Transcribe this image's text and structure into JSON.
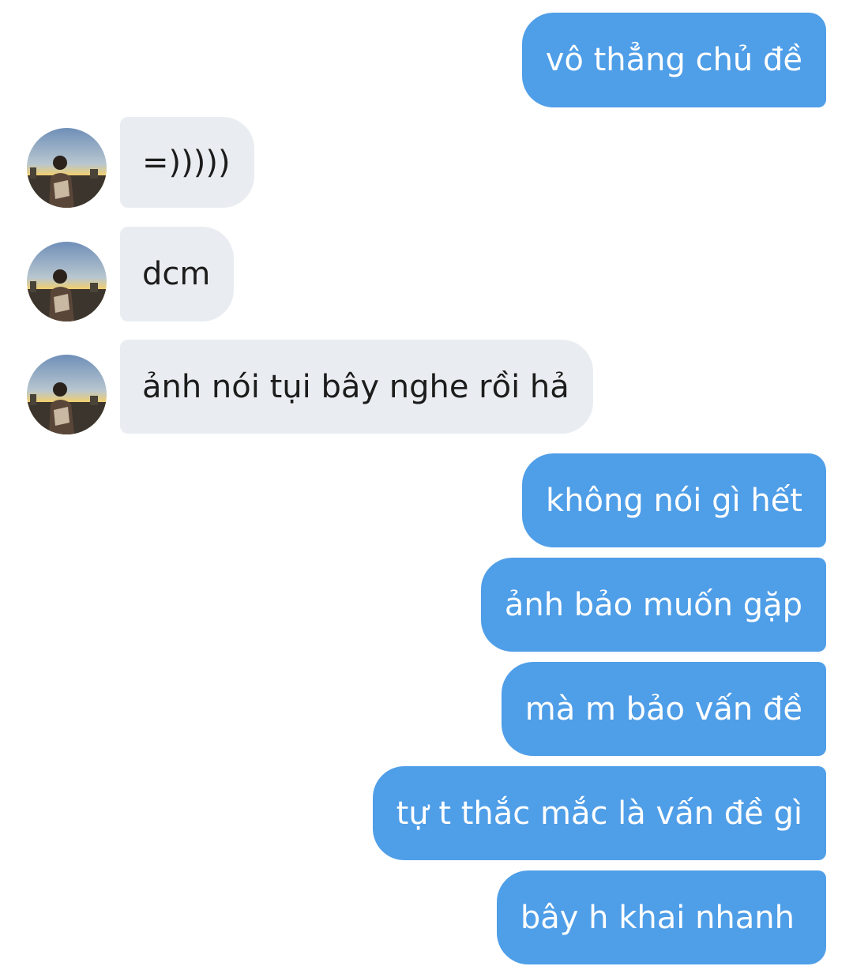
{
  "messages": [
    {
      "id": "m1",
      "direction": "outgoing",
      "text": "vô thẳng chủ đề"
    },
    {
      "id": "m2",
      "direction": "incoming",
      "text": "=)))))"
    },
    {
      "id": "m3",
      "direction": "incoming",
      "text": "dcm"
    },
    {
      "id": "m4",
      "direction": "incoming",
      "text": "ảnh nói tụi bây nghe rồi hả"
    },
    {
      "id": "m5",
      "direction": "outgoing",
      "text": "không nói gì hết"
    },
    {
      "id": "m6",
      "direction": "outgoing",
      "text": "ảnh bảo muốn gặp"
    },
    {
      "id": "m7",
      "direction": "outgoing",
      "text": "mà m bảo vấn đề"
    },
    {
      "id": "m8",
      "direction": "outgoing",
      "text": "tự t thắc mắc là vấn đề gì"
    },
    {
      "id": "m9",
      "direction": "outgoing",
      "text": "bây h khai nhanh"
    }
  ],
  "colors": {
    "outgoing_bubble": "#4f9ee8",
    "incoming_bubble": "#e9edf1",
    "outgoing_text": "#ffffff",
    "incoming_text": "#1c1c1c",
    "background": "#ffffff"
  },
  "avatar": {
    "icon": "contact-avatar-photo"
  }
}
